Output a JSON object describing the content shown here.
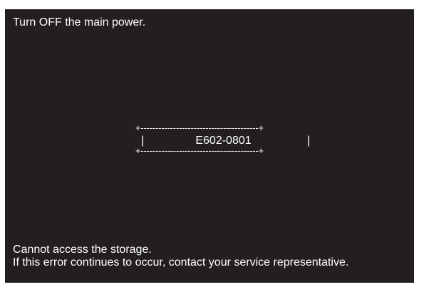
{
  "screen": {
    "background_color": "#231f20",
    "text_color": "#ffffff",
    "instruction": "Turn OFF the main power.",
    "error_box": {
      "top_border": "+----------------------------------------+",
      "bottom_border": "+----------------------------------------+",
      "left_side": "|",
      "right_side": "|",
      "code": "E602-0801"
    },
    "message": {
      "line1": "Cannot access the storage.",
      "line2": "If this error continues to occur, contact your service representative."
    }
  }
}
